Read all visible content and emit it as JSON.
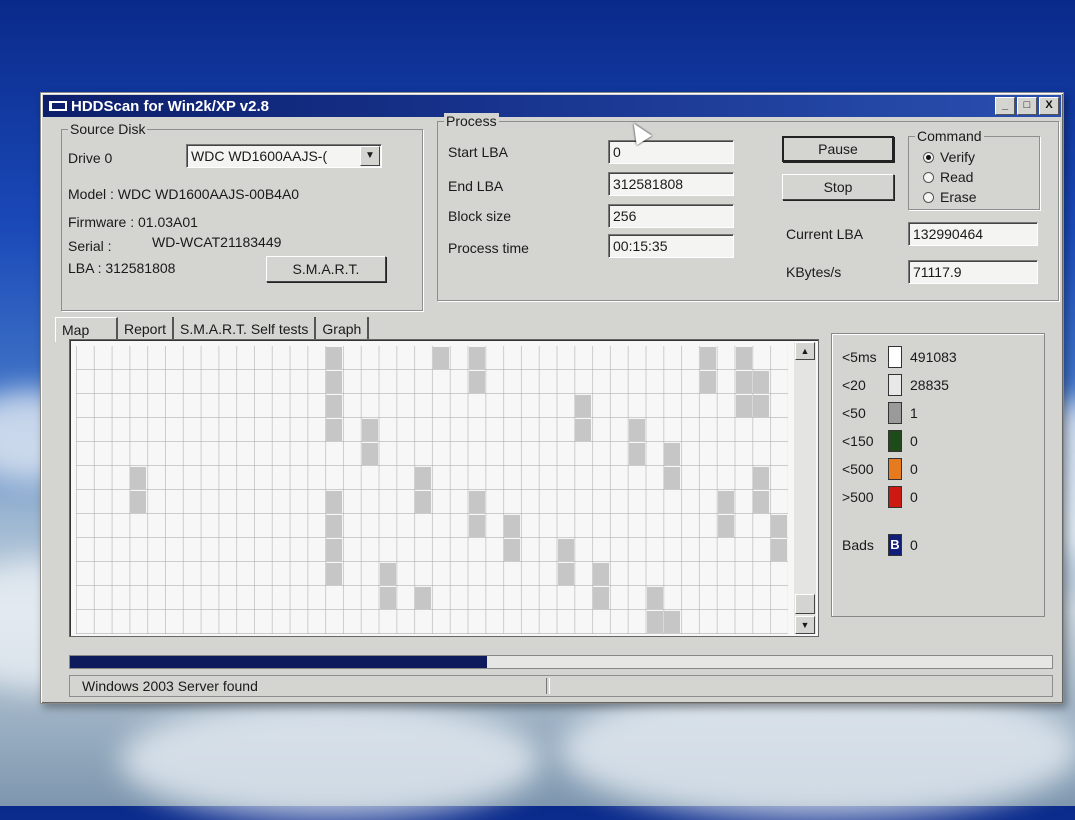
{
  "window": {
    "title": "HDDScan for Win2k/XP  v2.8",
    "controls": [
      "_",
      "□",
      "X"
    ]
  },
  "source_disk": {
    "group_label": "Source Disk",
    "drive_label": "Drive  0",
    "drive_selected": "WDC WD1600AAJS-(",
    "model": "Model : WDC WD1600AAJS-00B4A0",
    "firmware": "Firmware : 01.03A01",
    "serial_label": "Serial :",
    "serial_value": "WD-WCAT21183449",
    "lba": "LBA :  312581808",
    "smart_button": "S.M.A.R.T."
  },
  "process": {
    "group_label": "Process",
    "start_lba_label": "Start LBA",
    "start_lba": "0",
    "end_lba_label": "End LBA",
    "end_lba": "312581808",
    "block_size_label": "Block size",
    "block_size": "256",
    "process_time_label": "Process time",
    "process_time": "00:15:35",
    "pause_button": "Pause",
    "stop_button": "Stop",
    "current_lba_label": "Current LBA",
    "current_lba": "132990464",
    "kbytes_label": "KBytes/s",
    "kbytes": "71117.9"
  },
  "command": {
    "group_label": "Command",
    "options": [
      {
        "label": "Verify",
        "selected": true
      },
      {
        "label": "Read",
        "selected": false
      },
      {
        "label": "Erase",
        "selected": false
      }
    ]
  },
  "tabs": [
    "Map",
    "Report",
    "S.M.A.R.T. Self tests",
    "Graph"
  ],
  "legend": [
    {
      "key": "<5ms",
      "count": "491083",
      "color": "#ffffff"
    },
    {
      "key": "<20",
      "count": "28835",
      "color": "#e8e8e8"
    },
    {
      "key": "<50",
      "count": "1",
      "color": "#9a9a9a"
    },
    {
      "key": "<150",
      "count": "0",
      "color": "#1f4a1a"
    },
    {
      "key": "<500",
      "count": "0",
      "color": "#e67a1e"
    },
    {
      "key": ">500",
      "count": "0",
      "color": "#cc1a12"
    }
  ],
  "bads": {
    "label": "Bads",
    "glyph": "B",
    "count": "0",
    "color": "#101e7a"
  },
  "progress": {
    "fraction": 0.425
  },
  "status": {
    "text": "Windows 2003 Server found"
  }
}
